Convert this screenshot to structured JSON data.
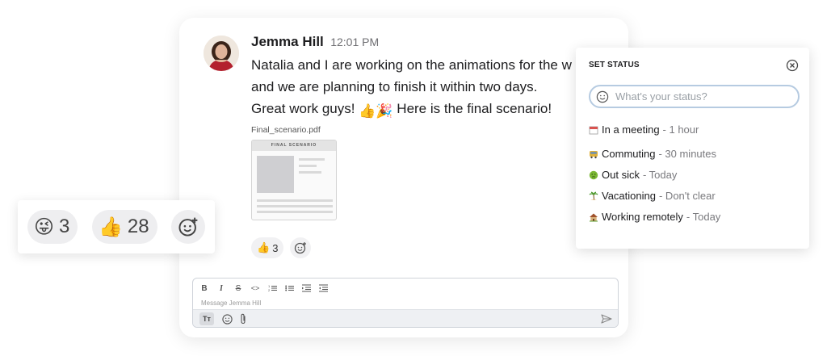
{
  "message": {
    "author": "Jemma Hill",
    "time": "12:01 PM",
    "line1": "Natalia and I are working on the animations for the w",
    "line2": "and we are planning to finish it within two days.",
    "line3_a": "Great work guys! ",
    "line3_b": "  Here is the final scenario!",
    "emoji_thumbs": "👍",
    "emoji_party": "🎉"
  },
  "attachment": {
    "file_name": "Final_scenario.pdf",
    "thumb_title": "FINAL SCENARIO"
  },
  "message_reactions": [
    {
      "emoji": "👍",
      "count": "3"
    }
  ],
  "composer": {
    "placeholder": "Message Jemma Hill",
    "format_buttons": [
      "B",
      "I",
      "S",
      "<>",
      "ordered-list",
      "bullet-list",
      "indent",
      "outdent"
    ],
    "text_format_label": "Tт"
  },
  "reactions_panel": {
    "items": [
      {
        "emoji": "😜",
        "count": "3"
      },
      {
        "emoji": "👍",
        "count": "28"
      }
    ]
  },
  "status_panel": {
    "title": "SET STATUS",
    "placeholder": "What's your status?",
    "items": [
      {
        "icon": "calendar-icon",
        "label": "In a meeting",
        "duration": " - 1 hour",
        "color": "#d9534f"
      },
      {
        "icon": "bus-icon",
        "label": "Commuting",
        "duration": "  - 30 minutes",
        "color": "#c79a2e"
      },
      {
        "icon": "sick-icon",
        "label": "Out sick",
        "duration": " - Today",
        "color": "#6cab2c"
      },
      {
        "icon": "palm-tree-icon",
        "label": "Vacationing",
        "duration": " - Don't clear",
        "color": "#5c9e3a"
      },
      {
        "icon": "house-icon",
        "label": "Working remotely",
        "duration": " - Today",
        "color": "#8a6a4a"
      }
    ]
  }
}
